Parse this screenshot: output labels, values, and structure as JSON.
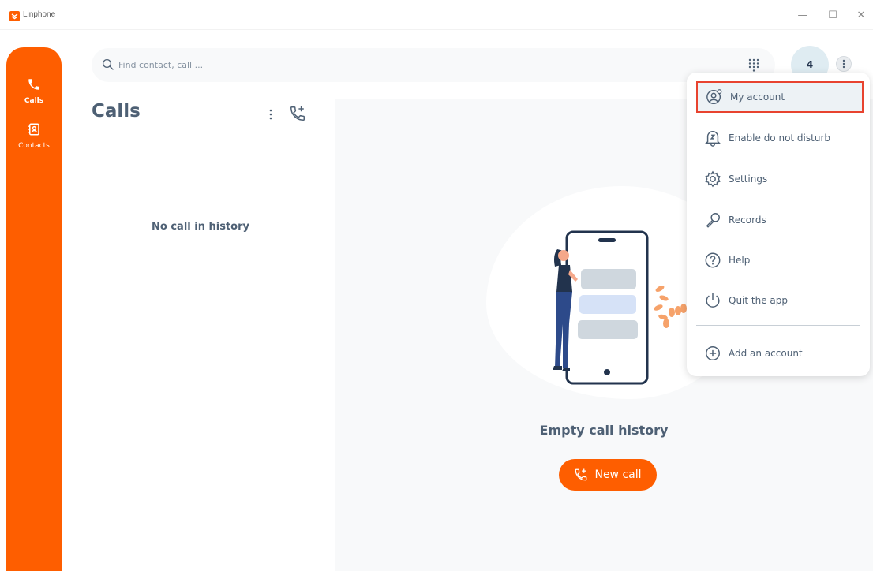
{
  "window": {
    "title": "Linphone",
    "controls": {
      "minimize": "—",
      "maximize": "☐",
      "close": "✕"
    }
  },
  "sidebar": {
    "items": [
      {
        "label": "Calls",
        "icon": "phone-icon",
        "active": true
      },
      {
        "label": "Contacts",
        "icon": "contacts-icon",
        "active": false
      }
    ]
  },
  "search": {
    "placeholder": "Find contact, call ...",
    "value": ""
  },
  "account": {
    "avatar_text": "4"
  },
  "calls_panel": {
    "title": "Calls",
    "empty_text": "No call in history"
  },
  "main": {
    "empty_title": "Empty call history",
    "new_call_label": "New call"
  },
  "menu": {
    "items": [
      {
        "label": "My account",
        "icon": "account-settings-icon",
        "highlighted": true
      },
      {
        "label": "Enable do not disturb",
        "icon": "bell-z-icon"
      },
      {
        "label": "Settings",
        "icon": "gear-icon"
      },
      {
        "label": "Records",
        "icon": "microphone-icon"
      },
      {
        "label": "Help",
        "icon": "help-icon"
      },
      {
        "label": "Quit the app",
        "icon": "power-icon"
      },
      {
        "label": "Add an account",
        "icon": "add-circle-icon"
      }
    ]
  },
  "colors": {
    "accent": "#fe5e00",
    "text": "#4e6074",
    "highlight_border": "#e8432f"
  }
}
